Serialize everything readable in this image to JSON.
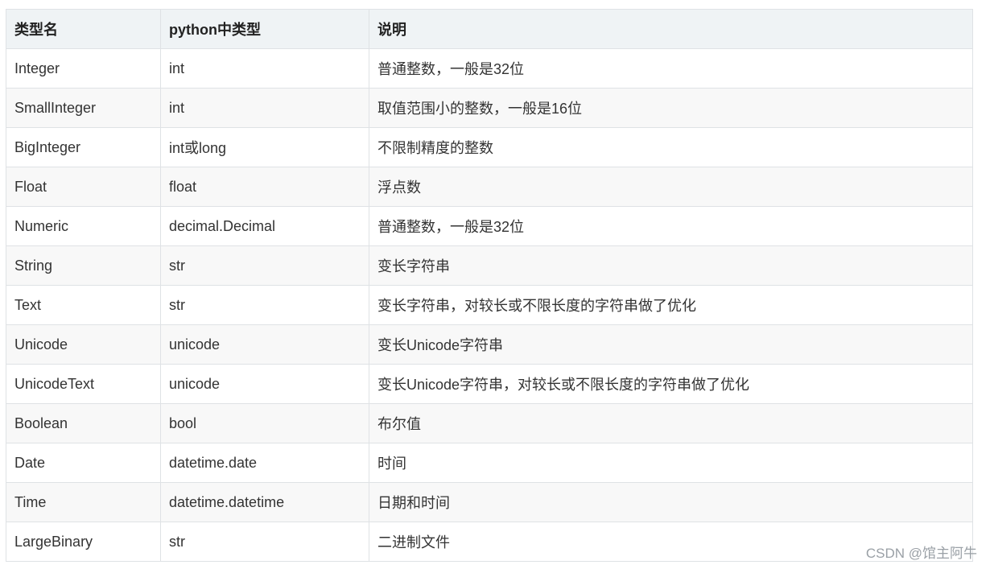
{
  "table": {
    "headers": [
      "类型名",
      "python中类型",
      "说明"
    ],
    "rows": [
      [
        "Integer",
        "int",
        "普通整数，一般是32位"
      ],
      [
        "SmallInteger",
        "int",
        "取值范围小的整数，一般是16位"
      ],
      [
        "BigInteger",
        "int或long",
        "不限制精度的整数"
      ],
      [
        "Float",
        "float",
        "浮点数"
      ],
      [
        "Numeric",
        "decimal.Decimal",
        "普通整数，一般是32位"
      ],
      [
        "String",
        "str",
        "变长字符串"
      ],
      [
        "Text",
        "str",
        "变长字符串，对较长或不限长度的字符串做了优化"
      ],
      [
        "Unicode",
        "unicode",
        "变长Unicode字符串"
      ],
      [
        "UnicodeText",
        "unicode",
        "变长Unicode字符串，对较长或不限长度的字符串做了优化"
      ],
      [
        "Boolean",
        "bool",
        "布尔值"
      ],
      [
        "Date",
        "datetime.date",
        "时间"
      ],
      [
        "Time",
        "datetime.datetime",
        "日期和时间"
      ],
      [
        "LargeBinary",
        "str",
        "二进制文件"
      ]
    ]
  },
  "watermark": "CSDN @馆主阿牛"
}
